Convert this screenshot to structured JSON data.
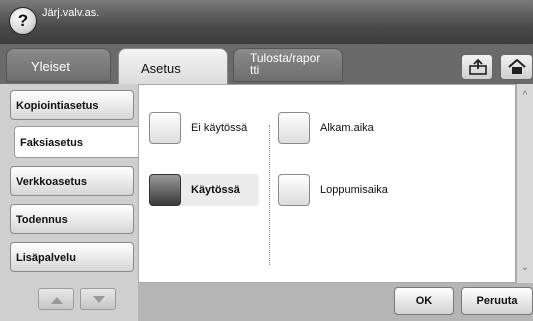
{
  "header": {
    "title": "Järj.valv.as.",
    "help_label": "?"
  },
  "tabs": [
    {
      "label": "Yleiset",
      "active": false
    },
    {
      "label": "Asetus",
      "active": true
    },
    {
      "label": "Tulosta/rapor\ntti",
      "active": false
    }
  ],
  "toolbar_icons": [
    "export-icon",
    "home-icon"
  ],
  "sidebar": {
    "items": [
      {
        "label": "Kopiointiasetus",
        "active": false
      },
      {
        "label": "Faksiasetus",
        "active": true
      },
      {
        "label": "Verkkoasetus",
        "active": false
      },
      {
        "label": "Todennus",
        "active": false
      },
      {
        "label": "Lisäpalvelu",
        "active": false
      }
    ],
    "scroll_icons": [
      "scroll-up-icon",
      "scroll-down-icon"
    ]
  },
  "options": {
    "left": [
      {
        "label": "Ei käytössä",
        "checked": false
      },
      {
        "label": "Käytössä",
        "checked": true
      }
    ],
    "right": [
      {
        "label": "Alkam.aika"
      },
      {
        "label": "Loppumisaika"
      }
    ]
  },
  "footer": {
    "ok_label": "OK",
    "cancel_label": "Peruuta"
  },
  "colors": {
    "title_bar": "#4a4a4a",
    "tab_bar": "#6a6a6a",
    "active_tab": "#f4f4f4",
    "checked_box": "#3a3a3a"
  }
}
